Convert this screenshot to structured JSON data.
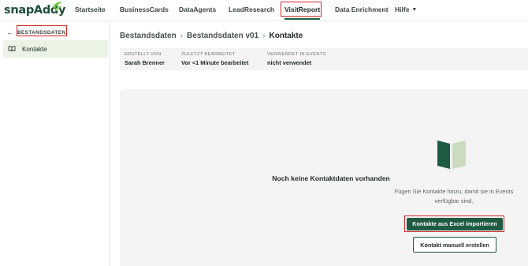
{
  "app": {
    "logo_text": "snapAddy"
  },
  "nav": {
    "items": [
      "Startseite",
      "BusinessCards",
      "DataAgents",
      "LeadResearch",
      "VisitReport",
      "Data Enrichment",
      "Hilfe"
    ],
    "active": "VisitReport"
  },
  "sidebar": {
    "back_label": "BESTANDSDATEN",
    "items": [
      {
        "label": "Kontakte",
        "icon": "book-icon",
        "selected": true
      }
    ]
  },
  "breadcrumb": [
    "Bestandsdaten",
    "Bestandsdaten v01",
    "Kontakte"
  ],
  "meta": {
    "created_by_label": "ERSTELLT VON",
    "created_by": "Sarah Brenner",
    "last_edited_label": "ZULETZT BEARBEITET",
    "last_edited": "Vor <1 Minute bearbeitet",
    "used_in_events_label": "VERWENDET IN EVENTS",
    "used_in_events": "nicht verwendet"
  },
  "empty_state": {
    "icon": "open-book-icon",
    "title": "Noch keine Kontaktdaten vorhanden",
    "description": "Fügen Sie Kontakte hinzu, damit sie in Events verfügbar sind.",
    "primary_button": "Kontakte aus Excel importieren",
    "secondary_button": "Kontakt manuell erstellen"
  },
  "colors": {
    "brand_green": "#1f5a42",
    "highlight_red": "#d42727",
    "sidebar_selected_bg": "#eaf3e4",
    "panel_bg": "#f3f4f3"
  }
}
